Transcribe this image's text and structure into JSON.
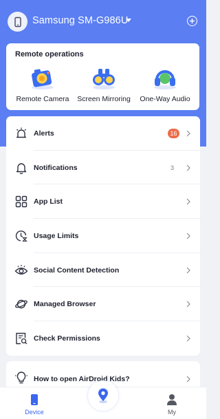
{
  "header": {
    "device_name": "Samsung SM-G986U",
    "device_icon": "phone-icon",
    "add_icon": "plus-circle-icon"
  },
  "remote": {
    "title": "Remote operations",
    "items": [
      {
        "label": "Remote Camera",
        "icon": "camera-icon"
      },
      {
        "label": "Screen Mirroring",
        "icon": "binoculars-icon"
      },
      {
        "label": "One-Way Audio",
        "icon": "headphones-icon"
      }
    ]
  },
  "menu": {
    "items": [
      {
        "label": "Alerts",
        "icon": "alarm-icon",
        "badge": "16",
        "badge_style": "red"
      },
      {
        "label": "Notifications",
        "icon": "bell-icon",
        "badge": "3",
        "badge_style": "plain"
      },
      {
        "label": "App List",
        "icon": "grid-icon"
      },
      {
        "label": "Usage Limits",
        "icon": "hourglass-clock-icon"
      },
      {
        "label": "Social Content Detection",
        "icon": "eye-icon"
      },
      {
        "label": "Managed Browser",
        "icon": "planet-icon"
      },
      {
        "label": "Check Permissions",
        "icon": "permissions-icon"
      }
    ]
  },
  "help": {
    "label": "How to open AirDroid Kids?",
    "icon": "lightbulb-icon"
  },
  "bottom_nav": {
    "tabs": [
      {
        "label": "Device",
        "icon": "phone-icon",
        "active": true
      },
      {
        "label": "My",
        "icon": "user-icon",
        "active": false
      }
    ],
    "center_icon": "location-pin-icon"
  },
  "colors": {
    "primary": "#5b7ff2",
    "background": "#f1f2f6",
    "alert_badge": "#ec6d4a",
    "active_tab": "#3b66ee",
    "inactive_tab": "#555861"
  }
}
